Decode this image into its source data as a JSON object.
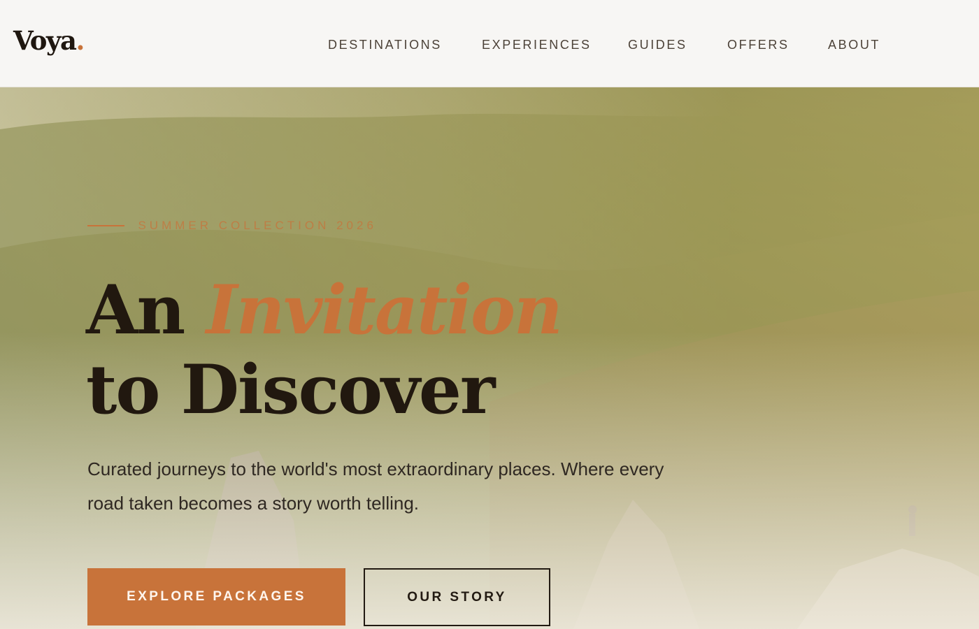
{
  "brand": {
    "name": "Voya",
    "dot": ".",
    "accent_color": "#c8733a"
  },
  "nav": {
    "items": [
      {
        "label": "DESTINATIONS"
      },
      {
        "label": "EXPERIENCES"
      },
      {
        "label": "GUIDES"
      },
      {
        "label": "OFFERS"
      },
      {
        "label": "ABOUT"
      }
    ]
  },
  "hero": {
    "eyebrow": "SUMMER COLLECTION 2026",
    "headline": {
      "part1": "An",
      "accent": "Invitation",
      "part2": "to Discover"
    },
    "subtext": "Curated journeys to the world's most extraordinary places. Where every road taken becomes a story worth telling.",
    "primary_button": "EXPLORE PACKAGES",
    "secondary_button": "OUR STORY",
    "background_image": "misty mountain valley with rock formations and hiker"
  },
  "colors": {
    "accent": "#c8733a",
    "text_dark": "#21180f",
    "header_bg": "#f7f6f4"
  }
}
